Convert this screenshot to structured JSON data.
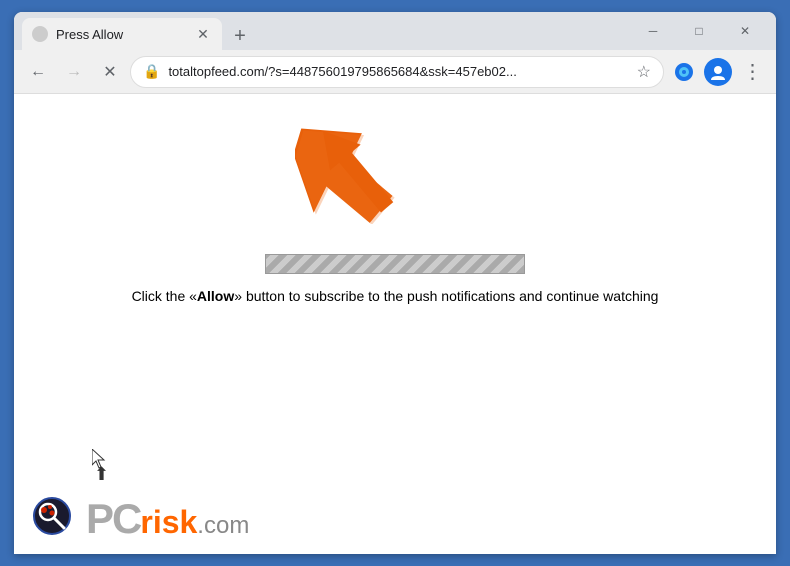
{
  "window": {
    "title": "Press Allow",
    "minimize_label": "─",
    "maximize_label": "□",
    "close_label": "✕"
  },
  "tab": {
    "title": "Press Allow",
    "new_tab_label": "+"
  },
  "toolbar": {
    "back_label": "←",
    "forward_label": "→",
    "reload_label": "✕",
    "address": "totaltopfeed.com/?s=448756019795865684&ssk=457eb02...",
    "lock_icon": "🔒",
    "star_label": "☆",
    "profile_label": "👤",
    "menu_label": "⋮",
    "extension_icon": "🔵"
  },
  "page": {
    "instruction_prefix": "Click the «",
    "instruction_allow": "Allow",
    "instruction_suffix": "» button to subscribe to the push notifications and continue watching"
  },
  "logo": {
    "pc_text": "PC",
    "risk_text": "risk",
    "dot_com": ".com"
  }
}
